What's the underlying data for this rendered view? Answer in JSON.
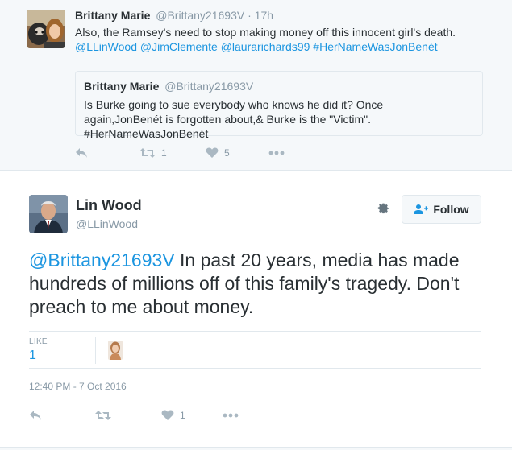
{
  "parent_tweet": {
    "name": "Brittany Marie",
    "handle": "@Brittany21693V",
    "separator": "·",
    "time": "17h",
    "text_plain": "Also, the Ramsey's need to stop making money off this innocent girl's death.",
    "mentions": [
      "@LLinWood",
      "@JimClemente",
      "@laurarichards99",
      "#HerNameWasJonBenét"
    ],
    "quoted": {
      "name": "Brittany Marie",
      "handle": "@Brittany21693V",
      "text": "Is Burke going to sue everybody who knows he did it? Once again,JonBenét is forgotten about,& Burke is the \"Victim\".  #HerNameWasJonBenét"
    },
    "actions": {
      "reply_icon": "reply-icon",
      "retweet_icon": "retweet-icon",
      "retweet_count": "1",
      "like_icon": "heart-icon",
      "like_count": "5",
      "more_icon": "more-icon"
    }
  },
  "main_tweet": {
    "name": "Lin Wood",
    "handle": "@LLinWood",
    "follow_label": "Follow",
    "mention": "@Brittany21693V",
    "text": " In past 20 years, media has made hundreds of millions off of this family's tragedy. Don't preach to me about money.",
    "stats": {
      "like_label": "LIKE",
      "like_value": "1"
    },
    "timestamp": "12:40 PM - 7 Oct 2016",
    "actions": {
      "reply_icon": "reply-icon",
      "retweet_icon": "retweet-icon",
      "like_icon": "heart-icon",
      "like_count": "1",
      "more_icon": "more-icon"
    }
  },
  "colors": {
    "link": "#1b95e0",
    "muted": "#8899a6",
    "icon": "#aab8c2",
    "text": "#292f33"
  }
}
